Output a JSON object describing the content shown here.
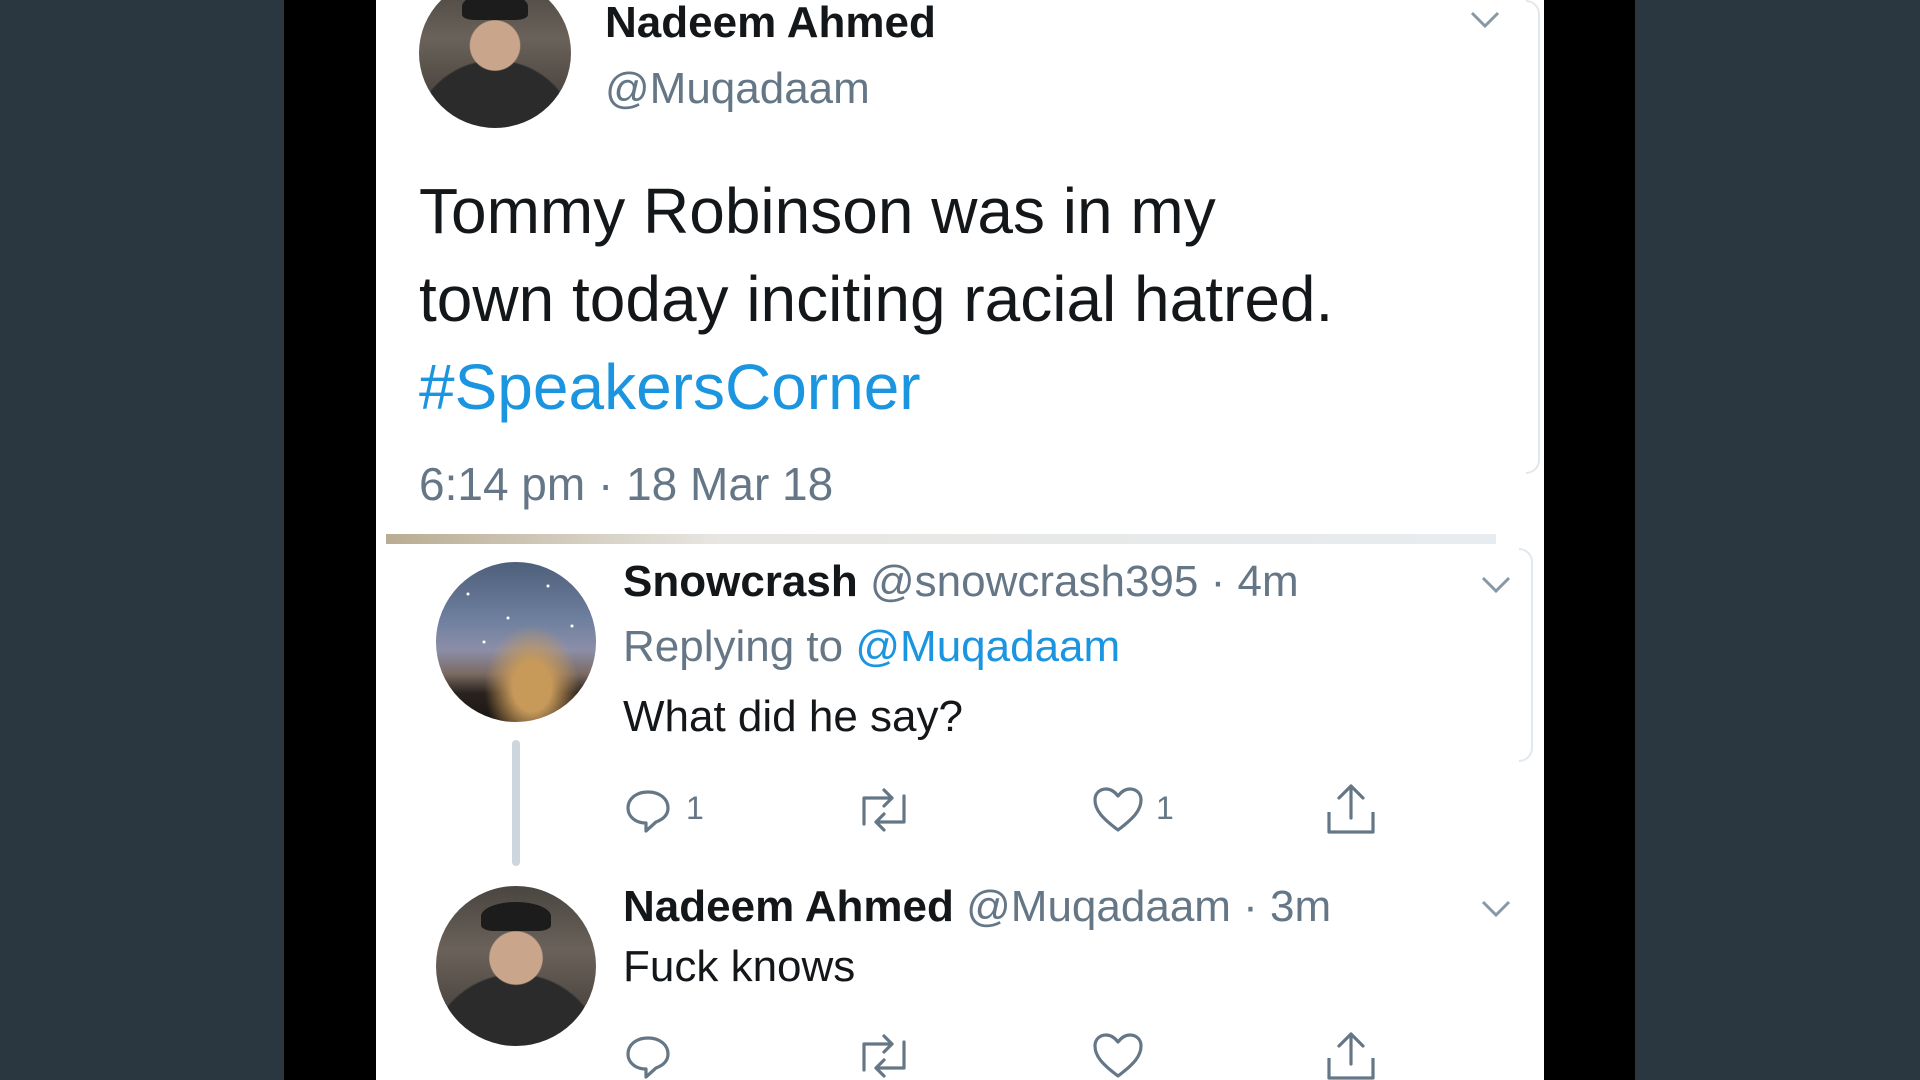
{
  "tweet": {
    "author_name": "Nadeem Ahmed",
    "author_handle": "@Muqadaam",
    "text_line1": "Tommy Robinson was in my",
    "text_line2": "town today inciting racial hatred.",
    "hashtag": "#SpeakersCorner",
    "timestamp": "6:14 pm · 18 Mar 18"
  },
  "replies": [
    {
      "name": "Snowcrash",
      "handle": "@snowcrash395",
      "time": "· 4m",
      "replying_prefix": "Replying to",
      "replying_to": "@Muqadaam",
      "text": "What did he say?",
      "reply_count": "1",
      "like_count": "1"
    },
    {
      "name": "Nadeem Ahmed",
      "handle": "@Muqadaam",
      "time": "· 3m",
      "text": "Fuck knows",
      "reply_count": "",
      "like_count": ""
    }
  ],
  "icons": {
    "avatar_1": "profile-photo-man-cap",
    "avatar_2": "profile-photo-night-sky",
    "reply": "speech-bubble-icon",
    "retweet": "retweet-arrows-icon",
    "like": "heart-icon",
    "share": "share-upload-icon",
    "menu": "chevron-down-icon"
  },
  "colors": {
    "page_bg": "#2b3740",
    "band": "#000000",
    "card": "#ffffff",
    "text": "#14171a",
    "muted": "#657786",
    "link": "#1b95e0"
  }
}
